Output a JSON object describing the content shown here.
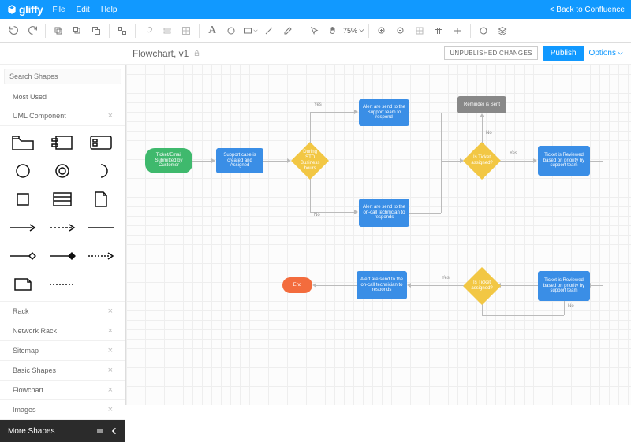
{
  "brand": "gliffy",
  "menus": [
    "File",
    "Edit",
    "Help"
  ],
  "back": "< Back to Confluence",
  "zoom": "75%",
  "doc": {
    "title": "Flowchart, v1",
    "status": "UNPUBLISHED CHANGES",
    "publish": "Publish",
    "options": "Options"
  },
  "search": {
    "placeholder": "Search Shapes"
  },
  "cats": {
    "most": "Most Used",
    "uml": "UML Component",
    "rest": [
      "Rack",
      "Network Rack",
      "Sitemap",
      "Basic Shapes",
      "Flowchart",
      "Images"
    ],
    "more": "More Shapes"
  },
  "nodes": {
    "start": "Ticket/Email Submitted by Customer",
    "case": "Support case is created and Assigned",
    "hours": "During STD Business hours",
    "alertSup": "Alert are send to the Support team to respond",
    "alertOn1": "Alert are send to the on-call technician to responds",
    "reminder": "Reminder is Sent",
    "assigned1": "Is Ticket assigned?",
    "review1": "Ticket is Reviewed based on priority by support team",
    "review2": "Ticket is Reviewed based on priority by support team",
    "assigned2": "Is Ticket assigned?",
    "alertOn2": "Alert are send to the on-call technician to responds",
    "end": "End"
  },
  "labels": {
    "yes": "Yes",
    "no": "No"
  }
}
